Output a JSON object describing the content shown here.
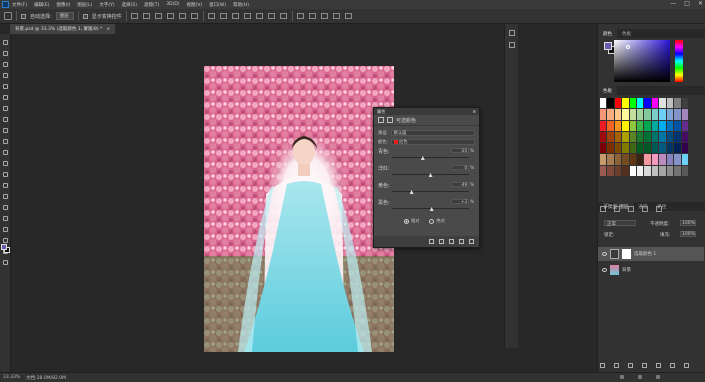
{
  "app": {
    "accent": "#31a8ff"
  },
  "menubar": {
    "items": [
      "文件(F)",
      "编辑(E)",
      "图像(I)",
      "图层(L)",
      "文字(Y)",
      "选择(S)",
      "滤镜(T)",
      "3D(D)",
      "视图(V)",
      "窗口(W)",
      "帮助(H)"
    ],
    "window_controls": [
      "—",
      "□",
      "✕"
    ]
  },
  "options": {
    "auto_select_label": "自动选择:",
    "auto_select_target": "图层",
    "show_transform_label": "显示变换控件"
  },
  "document_tab": {
    "title": "背景.psd @ 33.3% (选取颜色 1, 蒙版/8) *",
    "close": "×"
  },
  "statusbar": {
    "zoom": "33.33%",
    "doc_info": "文档:28.0M/82.0M"
  },
  "right_panel": {
    "color_tabs": [
      "颜色",
      "色板"
    ],
    "swatches_label": "色板",
    "layers_tabs": [
      "3D",
      "图层",
      "通道",
      "路径"
    ],
    "kind_label": "ρ 类型",
    "blend_mode": "正常",
    "opacity_label": "不透明度:",
    "opacity_value": "100%",
    "lock_label": "锁定:",
    "fill_label": "填充:",
    "fill_value": "100%",
    "layers": [
      {
        "name": "选取颜色 1",
        "type": "adjustment"
      },
      {
        "name": "背景",
        "type": "image"
      }
    ],
    "swatch_colors": [
      "#ffffff",
      "#000000",
      "#ff0000",
      "#ffff00",
      "#00ff00",
      "#00ffff",
      "#0000ff",
      "#ff00ff",
      "#e0e0e0",
      "#c0c0c0",
      "#808080",
      "#404040",
      "#f7977a",
      "#f9ad81",
      "#fdc68a",
      "#fff79a",
      "#c4df9b",
      "#a2d39c",
      "#82ca9d",
      "#7bcdc8",
      "#6ecff6",
      "#7ea7d8",
      "#8493ca",
      "#a187be",
      "#ed1c24",
      "#f26522",
      "#f7941d",
      "#fff200",
      "#8dc63f",
      "#39b54a",
      "#00a651",
      "#00a99d",
      "#00aeef",
      "#0072bc",
      "#0054a6",
      "#662d91",
      "#9e0b0f",
      "#a0410d",
      "#a36209",
      "#aba000",
      "#598527",
      "#1a7b30",
      "#007236",
      "#00746b",
      "#0076a3",
      "#004b80",
      "#003471",
      "#440e62",
      "#790000",
      "#7b2e00",
      "#7d4900",
      "#827b00",
      "#406618",
      "#005e20",
      "#005826",
      "#005952",
      "#005b7f",
      "#003663",
      "#002157",
      "#32004b",
      "#c69c6d",
      "#a67c52",
      "#8c6239",
      "#754c24",
      "#603913",
      "#3c2415",
      "#f5989d",
      "#f49ac1",
      "#bd8cbf",
      "#8781bd",
      "#8493ca",
      "#6dcff6",
      "#9b5b52",
      "#7f4a3a",
      "#6b3e2e",
      "#55301f",
      "#ffffff",
      "#f2f2f2",
      "#d9d9d9",
      "#bfbfbf",
      "#a6a6a6",
      "#8c8c8c",
      "#737373",
      "#595959"
    ]
  },
  "properties": {
    "title": "属性",
    "panel_name": "可选颜色",
    "preset_label": "预设:",
    "preset_value": "默认值",
    "colors_label": "颜色:",
    "colors_value": "红色",
    "sliders": [
      {
        "name": "青色:",
        "value": "-20",
        "fraction": 0.4
      },
      {
        "name": "洋红:",
        "value": "0",
        "fraction": 0.5
      },
      {
        "name": "黄色:",
        "value": "-49",
        "fraction": 0.255
      },
      {
        "name": "黑色:",
        "value": "+3",
        "fraction": 0.515
      }
    ],
    "pct": "%",
    "method_relative": "相对",
    "method_absolute": "绝对"
  }
}
